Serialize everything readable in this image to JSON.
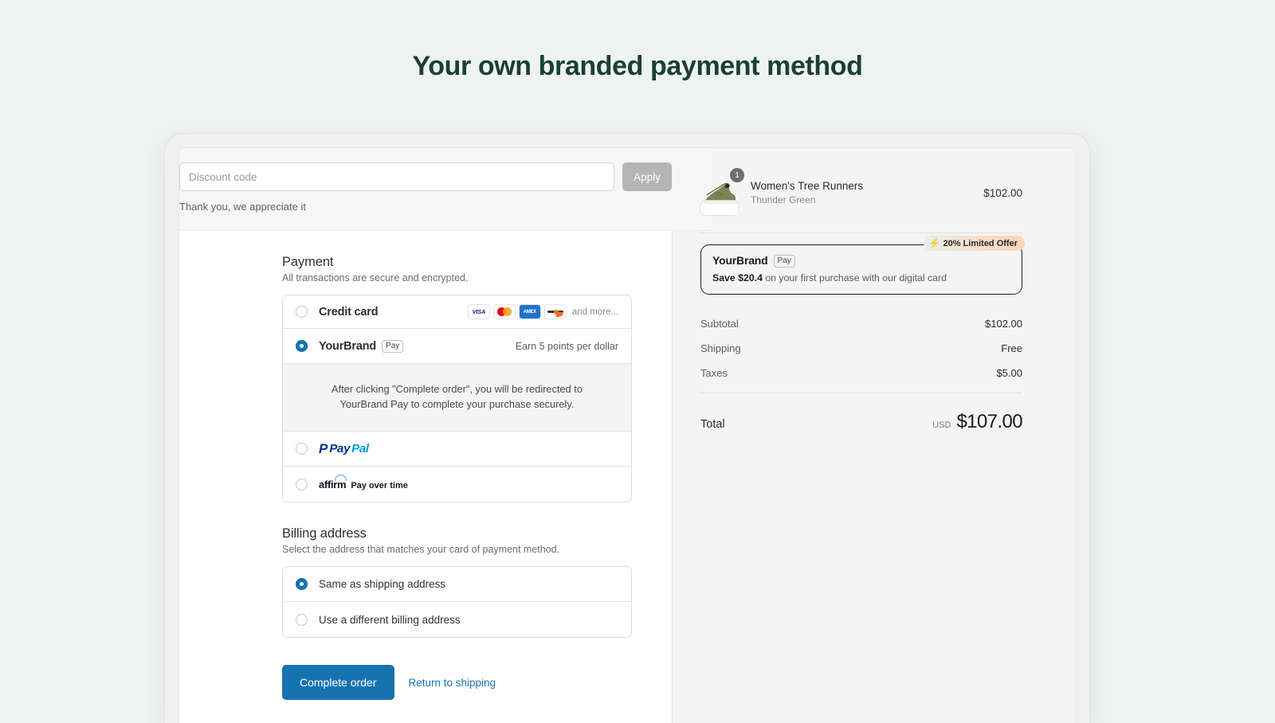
{
  "page": {
    "title": "Your own branded payment method"
  },
  "discount": {
    "placeholder": "Discount code",
    "value": "",
    "apply_label": "Apply",
    "note": "Thank you, we appreciate it"
  },
  "payment": {
    "heading": "Payment",
    "subheading": "All transactions are secure and encrypted.",
    "methods": [
      {
        "id": "credit-card",
        "label": "Credit card",
        "selected": false,
        "card_logos": [
          "VISA",
          "Mastercard",
          "AMEX",
          "Discover"
        ],
        "and_more": "and more..."
      },
      {
        "id": "yourbrand-pay",
        "label": "YourBrand",
        "chip": "Pay",
        "selected": true,
        "meta": "Earn 5 points per dollar",
        "redirect_note": "After clicking \"Complete order\", you will be redirected to YourBrand Pay to complete your purchase securely."
      },
      {
        "id": "paypal",
        "label": "PayPal",
        "selected": false
      },
      {
        "id": "affirm",
        "label": "affirm",
        "tagline": "Pay over time",
        "selected": false
      }
    ]
  },
  "billing": {
    "heading": "Billing address",
    "subheading": "Select the address that matches your card of payment method.",
    "options": [
      {
        "id": "same-as-shipping",
        "label": "Same as shipping address",
        "selected": true
      },
      {
        "id": "different-billing",
        "label": "Use a different billing address",
        "selected": false
      }
    ]
  },
  "actions": {
    "complete_label": "Complete order",
    "return_label": "Return to shipping"
  },
  "summary": {
    "product": {
      "name": "Women's Tree Runners",
      "variant": "Thunder Green",
      "price": "$102.00",
      "quantity": "1"
    },
    "promo": {
      "badge": "20% Limited Offer",
      "badge_icon": "bolt-icon",
      "brand": "YourBrand",
      "chip": "Pay",
      "save_amount": "Save $20.4",
      "save_rest": " on your first purchase with our digital card"
    },
    "lines": [
      {
        "label": "Subtotal",
        "value": "$102.00"
      },
      {
        "label": "Shipping",
        "value": "Free"
      },
      {
        "label": "Taxes",
        "value": "$5.00"
      }
    ],
    "total": {
      "label": "Total",
      "currency": "USD",
      "value": "$107.00"
    }
  },
  "colors": {
    "title": "#1c3f35",
    "accent": "#1773b0",
    "page_bg": "#eef3f2",
    "summary_bg": "#f4f4f4",
    "promo_badge_end": "#fbd3bb"
  }
}
